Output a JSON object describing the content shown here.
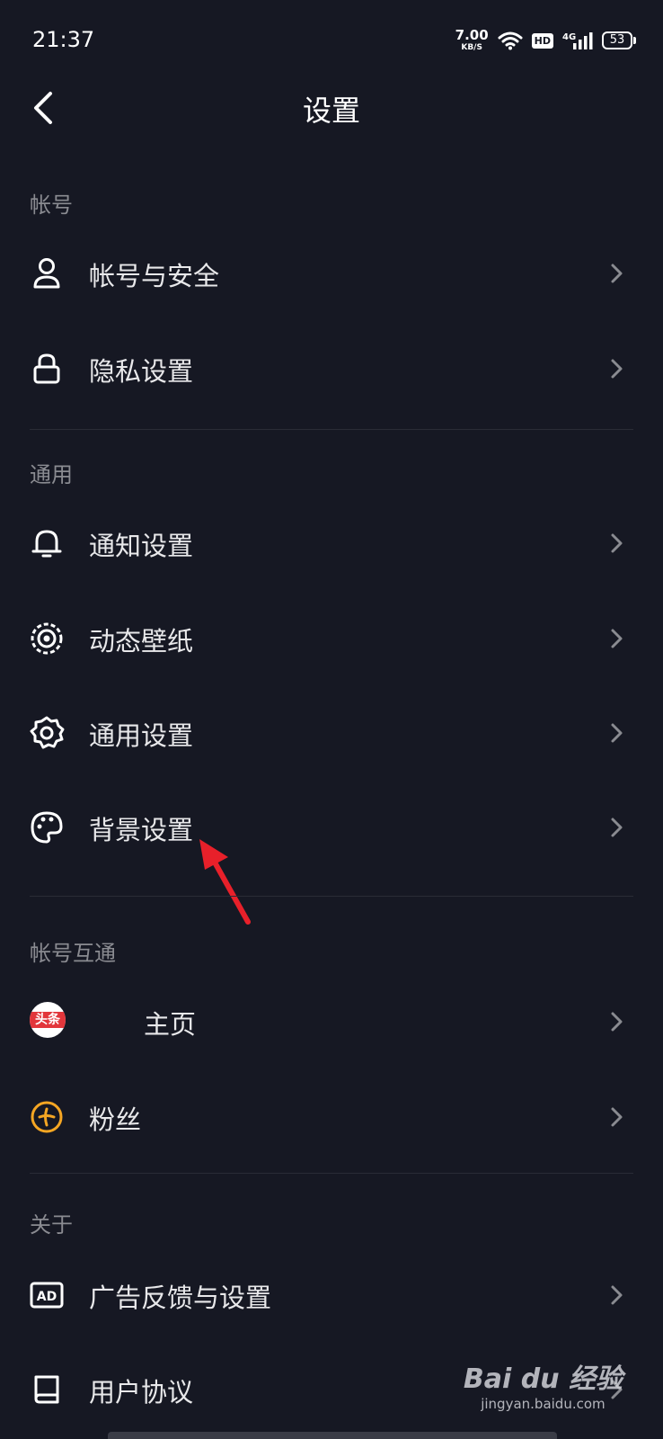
{
  "status_bar": {
    "time": "21:37",
    "speed_value": "7.00",
    "speed_unit": "KB/S",
    "hd": "HD",
    "network": "4G",
    "battery": "53"
  },
  "header": {
    "title": "设置"
  },
  "sections": {
    "account": {
      "title": "帐号",
      "items": [
        {
          "label": "帐号与安全",
          "icon": "user-icon"
        },
        {
          "label": "隐私设置",
          "icon": "lock-icon"
        }
      ]
    },
    "general": {
      "title": "通用",
      "items": [
        {
          "label": "通知设置",
          "icon": "bell-icon"
        },
        {
          "label": "动态壁纸",
          "icon": "wallpaper-icon"
        },
        {
          "label": "通用设置",
          "icon": "gear-icon"
        },
        {
          "label": "背景设置",
          "icon": "palette-icon"
        }
      ]
    },
    "linked": {
      "title": "帐号互通",
      "items": [
        {
          "label": "主页",
          "icon": "toutiao-icon",
          "badge": "头条"
        },
        {
          "label": "粉丝",
          "icon": "fans-icon"
        }
      ]
    },
    "about": {
      "title": "关于",
      "items": [
        {
          "label": "广告反馈与设置",
          "icon": "ad-icon",
          "badge": "AD"
        },
        {
          "label": "用户协议",
          "icon": "book-icon"
        }
      ]
    }
  },
  "watermark": {
    "logo": "Bai du 经验",
    "url": "jingyan.baidu.com"
  },
  "colors": {
    "background": "#161823",
    "annotation_arrow": "#e8202a",
    "fans_icon": "#f5a623"
  }
}
